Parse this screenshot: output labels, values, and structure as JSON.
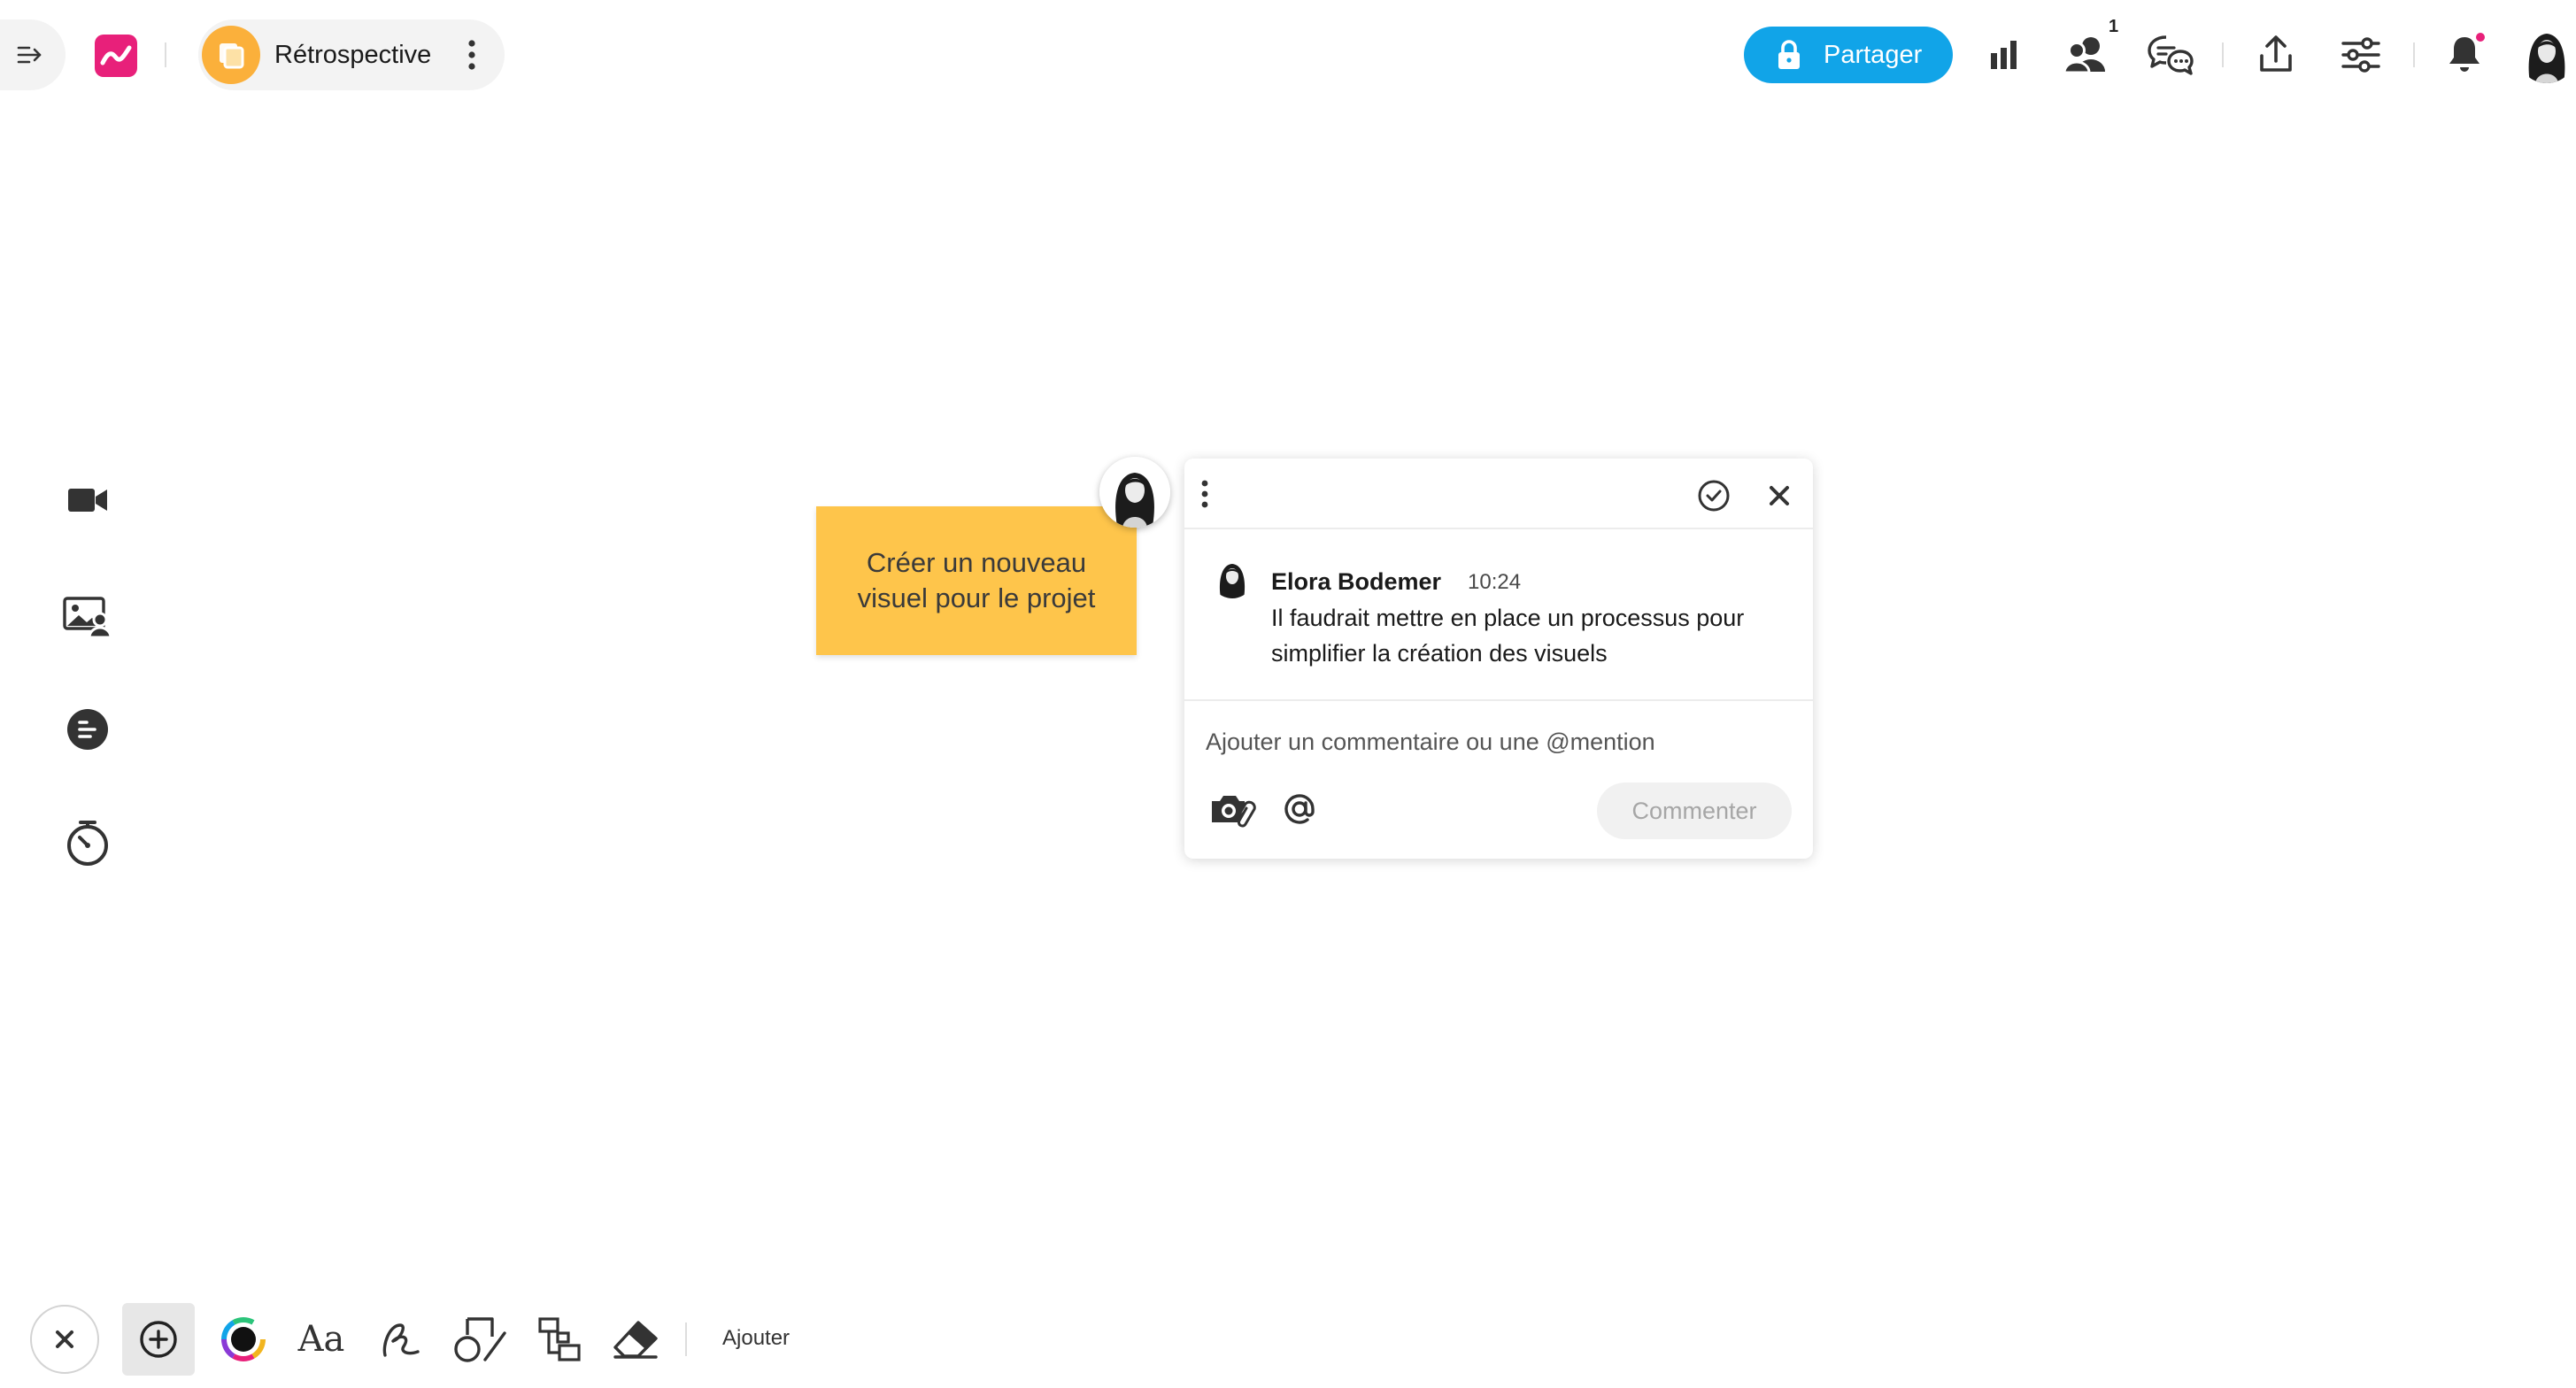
{
  "header": {
    "board_title": "Rétrospective",
    "share_label": "Partager",
    "collaborators_count": "1",
    "accent_color": "#11a4e8",
    "brand_color": "#e8207a",
    "board_icon_color": "#fbb03b",
    "notification_dot_color": "#e8207a"
  },
  "left_toolbar": {
    "items": [
      "video-icon",
      "image-people-icon",
      "notes-icon",
      "timer-icon"
    ]
  },
  "canvas": {
    "sticky_note": {
      "text": "Créer un nouveau\nvisuel pour le projet",
      "color": "#fec54b"
    }
  },
  "comment_panel": {
    "author": "Elora Bodemer",
    "time": "10:24",
    "text": "Il faudrait mettre en place un processus pour simplifier la création des visuels",
    "input_placeholder": "Ajouter un commentaire ou une @mention",
    "input_value": "",
    "submit_label": "Commenter"
  },
  "bottom_toolbar": {
    "add_label": "Ajouter",
    "text_tool_label": "Aa"
  }
}
